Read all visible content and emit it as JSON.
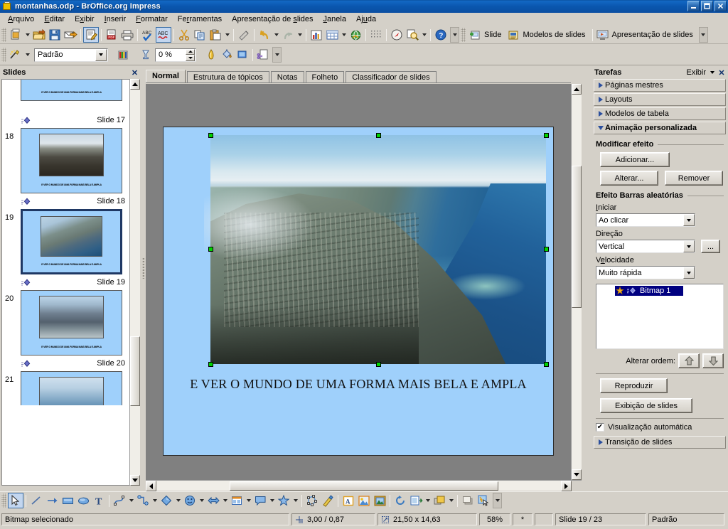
{
  "window": {
    "title": "montanhas.odp - BrOffice.org Impress",
    "minimize_label": "_",
    "maximize_label": "❐",
    "close_label": "✕"
  },
  "menubar": {
    "items": [
      {
        "label": "Arquivo",
        "accel": "A"
      },
      {
        "label": "Editar",
        "accel": "E"
      },
      {
        "label": "Exibir",
        "accel": "x"
      },
      {
        "label": "Inserir",
        "accel": "I"
      },
      {
        "label": "Formatar",
        "accel": "F"
      },
      {
        "label": "Ferramentas",
        "accel": "r"
      },
      {
        "label": "Apresentação de slides",
        "accel": "s"
      },
      {
        "label": "Janela",
        "accel": "J"
      },
      {
        "label": "Ajuda",
        "accel": "u"
      }
    ]
  },
  "toolbar_standard": {
    "icons": [
      "new-document-icon",
      "open-folder-icon",
      "save-icon",
      "send-email-icon",
      "edit-file-icon",
      "export-pdf-icon",
      "print-icon",
      "spellcheck-icon",
      "autospellcheck-icon",
      "cut-icon",
      "copy-icon",
      "paste-icon",
      "clone-formatting-icon",
      "undo-icon",
      "redo-icon",
      "chart-icon",
      "table-icon",
      "hyperlink-icon",
      "display-grid-icon",
      "navigator-icon",
      "zoom-icon",
      "help-icon"
    ],
    "buttons": [
      {
        "label": "Slide",
        "icon": "new-slide-icon"
      },
      {
        "label": "Modelos de slides",
        "icon": "slide-master-icon"
      },
      {
        "label": "Apresentação de slides",
        "icon": "start-slideshow-icon"
      }
    ],
    "overflow_label": "▾"
  },
  "toolbar_line_fill": {
    "style_value": "Padrão",
    "transparency_value": "0 %",
    "icons": [
      "line-style-icon",
      "fill-color-icon",
      "transparency-icon",
      "shadow-icon",
      "fill-bucket-icon",
      "3d-effects-icon",
      "crop-icon"
    ]
  },
  "slides_panel": {
    "title": "Slides",
    "close_label": "✕",
    "slides": [
      {
        "number": "17",
        "caption": "Slide 17",
        "selected": false,
        "partial": true
      },
      {
        "number": "18",
        "caption": "Slide 18",
        "selected": false,
        "thumb_text": "E VER O MUNDO DE UMA FORMA MAIS BELA E AMPLA"
      },
      {
        "number": "19",
        "caption": "Slide 19",
        "selected": true,
        "thumb_text": "E VER O MUNDO DE UMA FORMA MAIS BELA E AMPLA"
      },
      {
        "number": "20",
        "caption": "Slide 20",
        "selected": false,
        "thumb_text": "E VER O MUNDO DE UMA FORMA MAIS BELA E AMPLA"
      },
      {
        "number": "21",
        "caption": "",
        "selected": false,
        "partial": true
      }
    ]
  },
  "view_tabs": [
    {
      "label": "Normal",
      "active": true
    },
    {
      "label": "Estrutura de tópicos",
      "active": false
    },
    {
      "label": "Notas",
      "active": false
    },
    {
      "label": "Folheto",
      "active": false
    },
    {
      "label": "Classificador de slides",
      "active": false
    }
  ],
  "slide_canvas": {
    "caption_text": "E VER O MUNDO DE UMA FORMA MAIS BELA E AMPLA",
    "background_color": "#9fd0fb",
    "selection_handle_color": "#00d400"
  },
  "tasks_panel": {
    "title": "Tarefas",
    "view_label": "Exibir",
    "close_label": "✕",
    "sections": [
      {
        "label": "Páginas mestres",
        "open": false
      },
      {
        "label": "Layouts",
        "open": false
      },
      {
        "label": "Modelos de tabela",
        "open": false
      },
      {
        "label": "Animação personalizada",
        "open": true
      }
    ],
    "modify_effect": {
      "group_label": "Modificar efeito",
      "add_button": "Adicionar...",
      "change_button": "Alterar...",
      "remove_button": "Remover"
    },
    "effect": {
      "group_label": "Efeito Barras aleatórias",
      "start_label": "Iniciar",
      "start_value": "Ao clicar",
      "direction_label": "Direção",
      "direction_value": "Vertical",
      "options_button": "...",
      "speed_label": "Velocidade",
      "speed_value": "Muito rápida"
    },
    "animation_list": [
      {
        "label": "Bitmap 1",
        "selected": true,
        "icon": "animation-star-icon"
      }
    ],
    "order": {
      "label": "Alterar ordem:",
      "up_icon": "arrow-up-icon",
      "down_icon": "arrow-down-icon"
    },
    "play_button": "Reproduzir",
    "slideshow_button": "Exibição de slides",
    "auto_preview": {
      "label": "Visualização automática",
      "checked": true
    },
    "transition_section": {
      "label": "Transição de slides",
      "open": false
    }
  },
  "draw_toolbar": {
    "icons": [
      "select-arrow-icon",
      "line-icon",
      "arrow-line-icon",
      "rectangle-icon",
      "ellipse-icon",
      "text-icon",
      "curve-icon",
      "connector-icon",
      "basic-shapes-icon",
      "symbol-shapes-icon",
      "block-arrows-icon",
      "flowchart-icon",
      "callout-icon",
      "stars-icon",
      "points-icon",
      "glue-points-icon",
      "fontwork-icon",
      "from-file-image-icon",
      "gallery-icon",
      "rotate-icon",
      "alignment-icon",
      "arrange-icon",
      "shadow-toggle-icon",
      "interaction-icon"
    ],
    "active_tool": "select-arrow-icon"
  },
  "statusbar": {
    "message": "Bitmap selecionado",
    "position": "3,00 / 0,87",
    "size": "21,50 x 14,63",
    "zoom": "58%",
    "modified": "*",
    "slide_counter": "Slide 19 / 23",
    "master": "Padrão"
  }
}
